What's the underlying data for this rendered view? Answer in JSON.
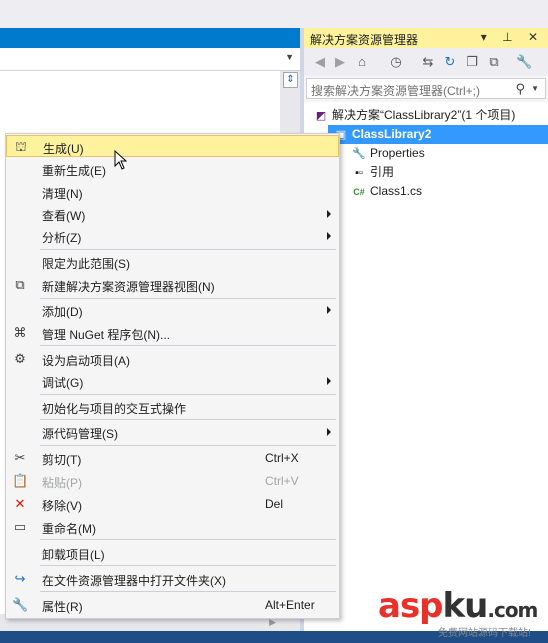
{
  "solution_explorer": {
    "title": "解决方案资源管理器",
    "title_buttons": "▾ ⊥ ✕",
    "search_placeholder": "搜索解决方案资源管理器(Ctrl+;)",
    "toolbar_icons": [
      "back-icon",
      "forward-icon",
      "home-icon",
      "history-icon",
      "sync-icon",
      "refresh-icon",
      "collapse-all-icon",
      "show-all-files-icon",
      "properties-wrench-icon"
    ],
    "tree": [
      {
        "label": "解决方案“ClassLibrary2”(1 个项目)",
        "icon": "solution-icon"
      },
      {
        "label": "ClassLibrary2",
        "icon": "csharp-project-icon",
        "selected": true
      },
      {
        "label": "Properties",
        "icon": "wrench-icon"
      },
      {
        "label": "引用",
        "icon": "references-icon"
      },
      {
        "label": "Class1.cs",
        "icon": "csharp-file-icon"
      }
    ]
  },
  "context_menu": {
    "items": [
      {
        "label": "生成(U)",
        "icon": "build-icon",
        "hover": true
      },
      {
        "label": "重新生成(E)"
      },
      {
        "label": "清理(N)"
      },
      {
        "label": "查看(W)",
        "submenu": true
      },
      {
        "label": "分析(Z)",
        "submenu": true
      },
      {
        "label": "限定为此范围(S)"
      },
      {
        "label": "新建解决方案资源管理器视图(N)",
        "icon": "new-view-icon"
      },
      {
        "label": "添加(D)",
        "submenu": true
      },
      {
        "label": "管理 NuGet 程序包(N)...",
        "icon": "nuget-icon"
      },
      {
        "label": "设为启动项目(A)",
        "icon": "gear-icon"
      },
      {
        "label": "调试(G)",
        "submenu": true
      },
      {
        "label": "初始化与项目的交互式操作"
      },
      {
        "label": "源代码管理(S)",
        "submenu": true
      },
      {
        "label": "剪切(T)",
        "icon": "cut-icon",
        "shortcut": "Ctrl+X"
      },
      {
        "label": "粘贴(P)",
        "icon": "paste-icon",
        "shortcut": "Ctrl+V",
        "disabled": true
      },
      {
        "label": "移除(V)",
        "icon": "remove-icon",
        "shortcut": "Del"
      },
      {
        "label": "重命名(M)",
        "icon": "rename-icon"
      },
      {
        "label": "卸载项目(L)"
      },
      {
        "label": "在文件资源管理器中打开文件夹(X)",
        "icon": "open-folder-icon"
      },
      {
        "label": "属性(R)",
        "icon": "properties-icon",
        "shortcut": "Alt+Enter"
      }
    ]
  },
  "watermark": {
    "brand_a": "asp",
    "brand_b": "ku",
    "brand_c": ".com",
    "subtitle": "免费网站源码下载站!"
  },
  "colors": {
    "accent": "#007ACC",
    "title_highlight": "#FFF29D",
    "selection": "#3399FF",
    "remove_red": "#E51400",
    "watermark_red": "#E8312A"
  }
}
